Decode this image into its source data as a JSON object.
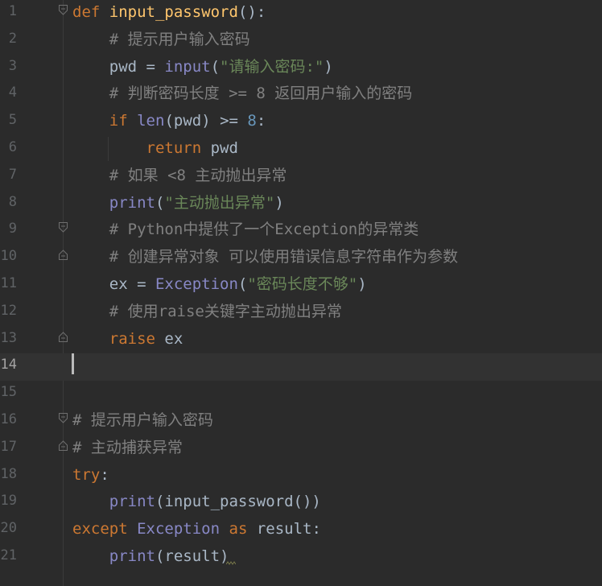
{
  "editor": {
    "lines": [
      {
        "n": "1",
        "tokens": [
          {
            "t": "def",
            "c": "kw"
          },
          {
            "t": " ",
            "c": "pl"
          },
          {
            "t": "input_password",
            "c": "fn"
          },
          {
            "t": "():",
            "c": "pl"
          }
        ]
      },
      {
        "n": "2",
        "tokens": [
          {
            "t": "    # 提示用户输入密码",
            "c": "cm"
          }
        ]
      },
      {
        "n": "3",
        "tokens": [
          {
            "t": "    pwd = ",
            "c": "pl"
          },
          {
            "t": "input",
            "c": "bi"
          },
          {
            "t": "(",
            "c": "pl"
          },
          {
            "t": "\"请输入密码:\"",
            "c": "str"
          },
          {
            "t": ")",
            "c": "pl"
          }
        ]
      },
      {
        "n": "4",
        "tokens": [
          {
            "t": "    # 判断密码长度 >= 8 返回用户输入的密码",
            "c": "cm"
          }
        ]
      },
      {
        "n": "5",
        "tokens": [
          {
            "t": "    ",
            "c": "pl"
          },
          {
            "t": "if",
            "c": "kw"
          },
          {
            "t": " ",
            "c": "pl"
          },
          {
            "t": "len",
            "c": "bi"
          },
          {
            "t": "(pwd) >= ",
            "c": "pl"
          },
          {
            "t": "8",
            "c": "num"
          },
          {
            "t": ":",
            "c": "pl"
          }
        ]
      },
      {
        "n": "6",
        "tokens": [
          {
            "t": "        ",
            "c": "pl"
          },
          {
            "t": "return",
            "c": "kw"
          },
          {
            "t": " pwd",
            "c": "pl"
          }
        ]
      },
      {
        "n": "7",
        "tokens": [
          {
            "t": "    # 如果 <8 主动抛出异常",
            "c": "cm"
          }
        ]
      },
      {
        "n": "8",
        "tokens": [
          {
            "t": "    ",
            "c": "pl"
          },
          {
            "t": "print",
            "c": "bi"
          },
          {
            "t": "(",
            "c": "pl"
          },
          {
            "t": "\"主动抛出异常\"",
            "c": "str"
          },
          {
            "t": ")",
            "c": "pl"
          }
        ]
      },
      {
        "n": "9",
        "tokens": [
          {
            "t": "    # Python中提供了一个Exception的异常类",
            "c": "cm"
          }
        ]
      },
      {
        "n": "10",
        "tokens": [
          {
            "t": "    # 创建异常对象 可以使用错误信息字符串作为参数",
            "c": "cm"
          }
        ]
      },
      {
        "n": "11",
        "tokens": [
          {
            "t": "    ex = ",
            "c": "pl"
          },
          {
            "t": "Exception",
            "c": "bi"
          },
          {
            "t": "(",
            "c": "pl"
          },
          {
            "t": "\"密码长度不够\"",
            "c": "str"
          },
          {
            "t": ")",
            "c": "pl"
          }
        ]
      },
      {
        "n": "12",
        "tokens": [
          {
            "t": "    # 使用raise关键字主动抛出异常",
            "c": "cm"
          }
        ]
      },
      {
        "n": "13",
        "tokens": [
          {
            "t": "    ",
            "c": "pl"
          },
          {
            "t": "raise",
            "c": "kw"
          },
          {
            "t": " ex",
            "c": "pl"
          }
        ]
      },
      {
        "n": "14",
        "tokens": []
      },
      {
        "n": "15",
        "tokens": []
      },
      {
        "n": "16",
        "tokens": [
          {
            "t": "# 提示用户输入密码",
            "c": "cm"
          }
        ]
      },
      {
        "n": "17",
        "tokens": [
          {
            "t": "# 主动捕获异常",
            "c": "cm"
          }
        ]
      },
      {
        "n": "18",
        "tokens": [
          {
            "t": "try",
            "c": "kw"
          },
          {
            "t": ":",
            "c": "pl"
          }
        ]
      },
      {
        "n": "19",
        "tokens": [
          {
            "t": "    ",
            "c": "pl"
          },
          {
            "t": "print",
            "c": "bi"
          },
          {
            "t": "(input_password())",
            "c": "pl"
          }
        ]
      },
      {
        "n": "20",
        "tokens": [
          {
            "t": "except",
            "c": "kw"
          },
          {
            "t": " ",
            "c": "pl"
          },
          {
            "t": "Exception",
            "c": "bi"
          },
          {
            "t": " ",
            "c": "pl"
          },
          {
            "t": "as",
            "c": "kw"
          },
          {
            "t": " result:",
            "c": "pl"
          }
        ]
      },
      {
        "n": "21",
        "tokens": [
          {
            "t": "    ",
            "c": "pl"
          },
          {
            "t": "print",
            "c": "bi"
          },
          {
            "t": "(result)",
            "c": "pl"
          }
        ]
      }
    ],
    "current_line": "14",
    "fold_markers": {
      "1": "fold-open-icon",
      "9": "fold-open-icon",
      "10": "fold-close-icon",
      "13": "fold-close-icon",
      "16": "fold-open-icon",
      "17": "fold-close-icon"
    },
    "colors": {
      "background": "#2b2b2b",
      "current_line": "#323232",
      "keyword": "#cc7832",
      "function": "#ffc66d",
      "builtin": "#8888c6",
      "string": "#6a8759",
      "number": "#6897bb",
      "comment": "#808080",
      "plain": "#a9b7c6"
    }
  }
}
